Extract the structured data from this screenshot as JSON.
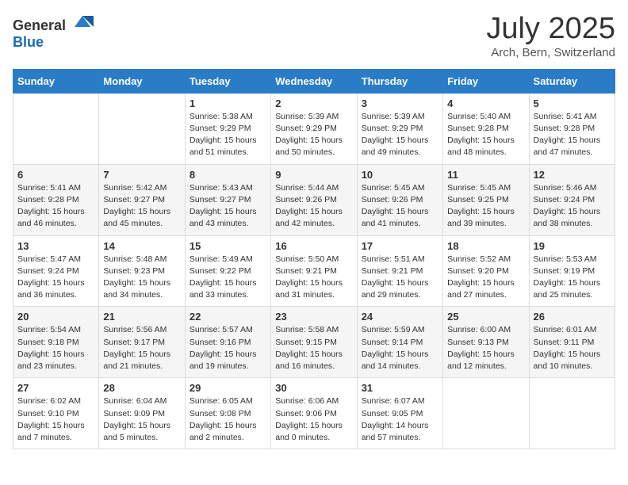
{
  "logo": {
    "general": "General",
    "blue": "Blue"
  },
  "title": {
    "month_year": "July 2025",
    "location": "Arch, Bern, Switzerland"
  },
  "weekdays": [
    "Sunday",
    "Monday",
    "Tuesday",
    "Wednesday",
    "Thursday",
    "Friday",
    "Saturday"
  ],
  "weeks": [
    [
      {
        "day": "",
        "sunrise": "",
        "sunset": "",
        "daylight": ""
      },
      {
        "day": "",
        "sunrise": "",
        "sunset": "",
        "daylight": ""
      },
      {
        "day": "1",
        "sunrise": "Sunrise: 5:38 AM",
        "sunset": "Sunset: 9:29 PM",
        "daylight": "Daylight: 15 hours and 51 minutes."
      },
      {
        "day": "2",
        "sunrise": "Sunrise: 5:39 AM",
        "sunset": "Sunset: 9:29 PM",
        "daylight": "Daylight: 15 hours and 50 minutes."
      },
      {
        "day": "3",
        "sunrise": "Sunrise: 5:39 AM",
        "sunset": "Sunset: 9:29 PM",
        "daylight": "Daylight: 15 hours and 49 minutes."
      },
      {
        "day": "4",
        "sunrise": "Sunrise: 5:40 AM",
        "sunset": "Sunset: 9:28 PM",
        "daylight": "Daylight: 15 hours and 48 minutes."
      },
      {
        "day": "5",
        "sunrise": "Sunrise: 5:41 AM",
        "sunset": "Sunset: 9:28 PM",
        "daylight": "Daylight: 15 hours and 47 minutes."
      }
    ],
    [
      {
        "day": "6",
        "sunrise": "Sunrise: 5:41 AM",
        "sunset": "Sunset: 9:28 PM",
        "daylight": "Daylight: 15 hours and 46 minutes."
      },
      {
        "day": "7",
        "sunrise": "Sunrise: 5:42 AM",
        "sunset": "Sunset: 9:27 PM",
        "daylight": "Daylight: 15 hours and 45 minutes."
      },
      {
        "day": "8",
        "sunrise": "Sunrise: 5:43 AM",
        "sunset": "Sunset: 9:27 PM",
        "daylight": "Daylight: 15 hours and 43 minutes."
      },
      {
        "day": "9",
        "sunrise": "Sunrise: 5:44 AM",
        "sunset": "Sunset: 9:26 PM",
        "daylight": "Daylight: 15 hours and 42 minutes."
      },
      {
        "day": "10",
        "sunrise": "Sunrise: 5:45 AM",
        "sunset": "Sunset: 9:26 PM",
        "daylight": "Daylight: 15 hours and 41 minutes."
      },
      {
        "day": "11",
        "sunrise": "Sunrise: 5:45 AM",
        "sunset": "Sunset: 9:25 PM",
        "daylight": "Daylight: 15 hours and 39 minutes."
      },
      {
        "day": "12",
        "sunrise": "Sunrise: 5:46 AM",
        "sunset": "Sunset: 9:24 PM",
        "daylight": "Daylight: 15 hours and 38 minutes."
      }
    ],
    [
      {
        "day": "13",
        "sunrise": "Sunrise: 5:47 AM",
        "sunset": "Sunset: 9:24 PM",
        "daylight": "Daylight: 15 hours and 36 minutes."
      },
      {
        "day": "14",
        "sunrise": "Sunrise: 5:48 AM",
        "sunset": "Sunset: 9:23 PM",
        "daylight": "Daylight: 15 hours and 34 minutes."
      },
      {
        "day": "15",
        "sunrise": "Sunrise: 5:49 AM",
        "sunset": "Sunset: 9:22 PM",
        "daylight": "Daylight: 15 hours and 33 minutes."
      },
      {
        "day": "16",
        "sunrise": "Sunrise: 5:50 AM",
        "sunset": "Sunset: 9:21 PM",
        "daylight": "Daylight: 15 hours and 31 minutes."
      },
      {
        "day": "17",
        "sunrise": "Sunrise: 5:51 AM",
        "sunset": "Sunset: 9:21 PM",
        "daylight": "Daylight: 15 hours and 29 minutes."
      },
      {
        "day": "18",
        "sunrise": "Sunrise: 5:52 AM",
        "sunset": "Sunset: 9:20 PM",
        "daylight": "Daylight: 15 hours and 27 minutes."
      },
      {
        "day": "19",
        "sunrise": "Sunrise: 5:53 AM",
        "sunset": "Sunset: 9:19 PM",
        "daylight": "Daylight: 15 hours and 25 minutes."
      }
    ],
    [
      {
        "day": "20",
        "sunrise": "Sunrise: 5:54 AM",
        "sunset": "Sunset: 9:18 PM",
        "daylight": "Daylight: 15 hours and 23 minutes."
      },
      {
        "day": "21",
        "sunrise": "Sunrise: 5:56 AM",
        "sunset": "Sunset: 9:17 PM",
        "daylight": "Daylight: 15 hours and 21 minutes."
      },
      {
        "day": "22",
        "sunrise": "Sunrise: 5:57 AM",
        "sunset": "Sunset: 9:16 PM",
        "daylight": "Daylight: 15 hours and 19 minutes."
      },
      {
        "day": "23",
        "sunrise": "Sunrise: 5:58 AM",
        "sunset": "Sunset: 9:15 PM",
        "daylight": "Daylight: 15 hours and 16 minutes."
      },
      {
        "day": "24",
        "sunrise": "Sunrise: 5:59 AM",
        "sunset": "Sunset: 9:14 PM",
        "daylight": "Daylight: 15 hours and 14 minutes."
      },
      {
        "day": "25",
        "sunrise": "Sunrise: 6:00 AM",
        "sunset": "Sunset: 9:13 PM",
        "daylight": "Daylight: 15 hours and 12 minutes."
      },
      {
        "day": "26",
        "sunrise": "Sunrise: 6:01 AM",
        "sunset": "Sunset: 9:11 PM",
        "daylight": "Daylight: 15 hours and 10 minutes."
      }
    ],
    [
      {
        "day": "27",
        "sunrise": "Sunrise: 6:02 AM",
        "sunset": "Sunset: 9:10 PM",
        "daylight": "Daylight: 15 hours and 7 minutes."
      },
      {
        "day": "28",
        "sunrise": "Sunrise: 6:04 AM",
        "sunset": "Sunset: 9:09 PM",
        "daylight": "Daylight: 15 hours and 5 minutes."
      },
      {
        "day": "29",
        "sunrise": "Sunrise: 6:05 AM",
        "sunset": "Sunset: 9:08 PM",
        "daylight": "Daylight: 15 hours and 2 minutes."
      },
      {
        "day": "30",
        "sunrise": "Sunrise: 6:06 AM",
        "sunset": "Sunset: 9:06 PM",
        "daylight": "Daylight: 15 hours and 0 minutes."
      },
      {
        "day": "31",
        "sunrise": "Sunrise: 6:07 AM",
        "sunset": "Sunset: 9:05 PM",
        "daylight": "Daylight: 14 hours and 57 minutes."
      },
      {
        "day": "",
        "sunrise": "",
        "sunset": "",
        "daylight": ""
      },
      {
        "day": "",
        "sunrise": "",
        "sunset": "",
        "daylight": ""
      }
    ]
  ]
}
